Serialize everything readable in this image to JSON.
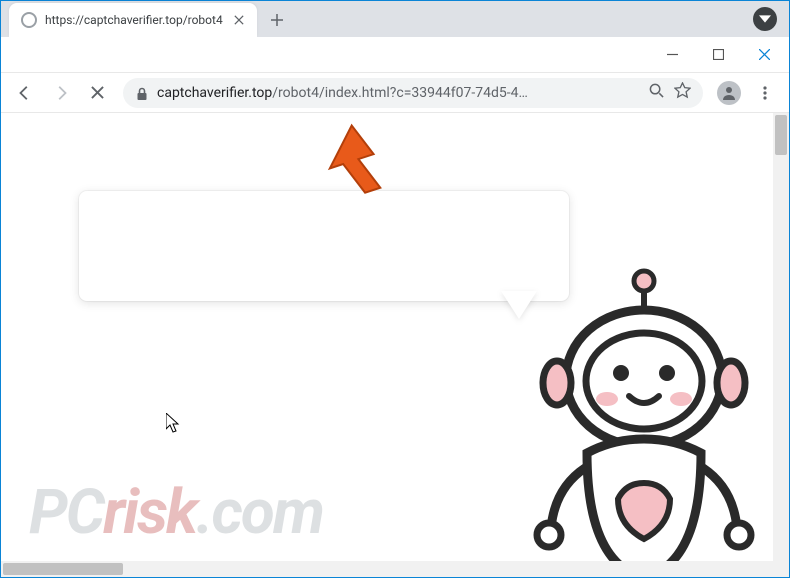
{
  "window": {
    "tab_title": "https://captchaverifier.top/robot4",
    "url_host": "captchaverifier.top",
    "url_path": "/robot4/index.html?c=33944f07-74d5-4…"
  },
  "watermark": {
    "prefix": "PC",
    "risk": "risk",
    "suffix": ".com"
  }
}
